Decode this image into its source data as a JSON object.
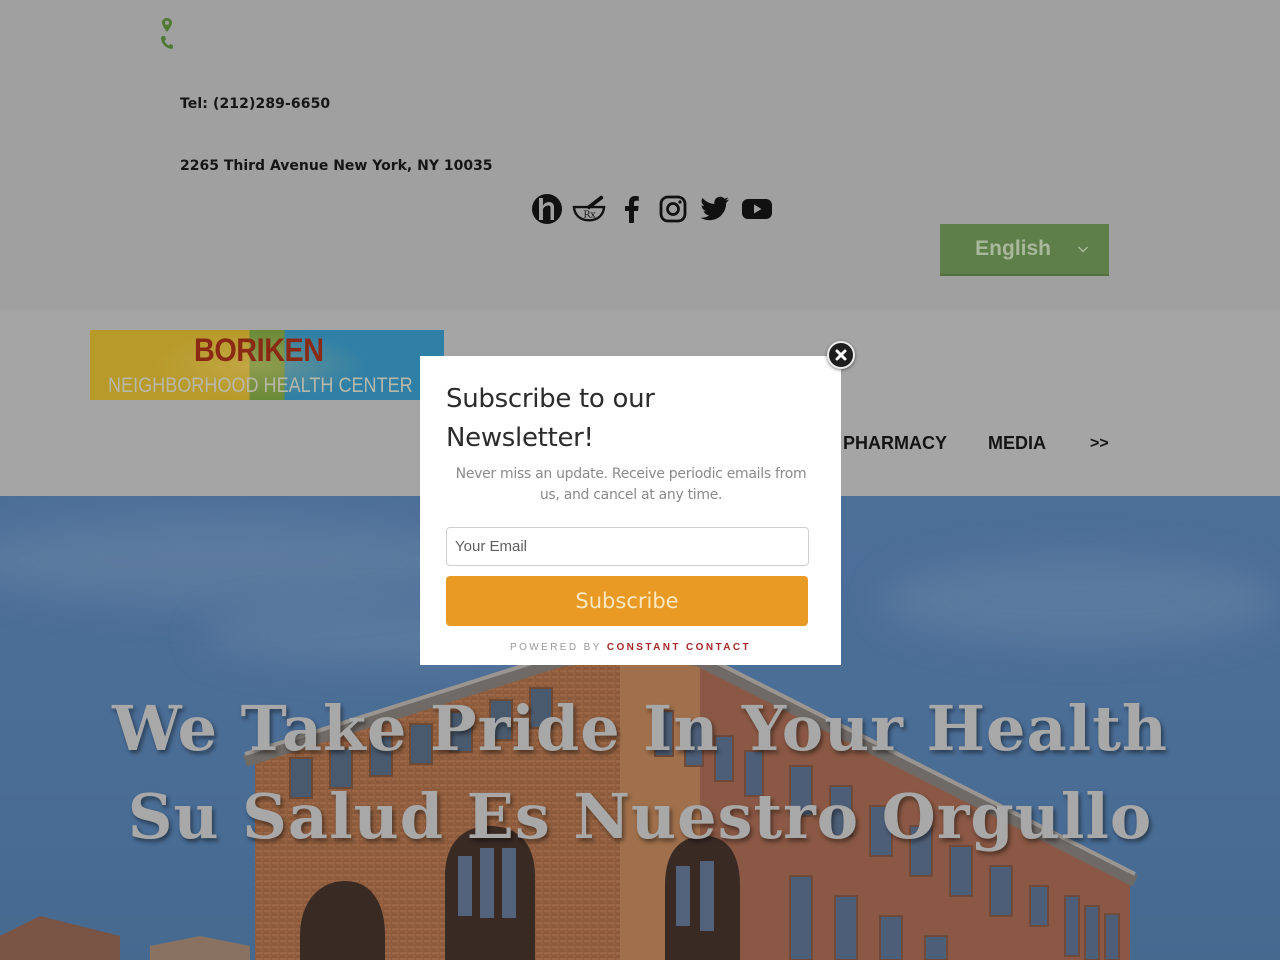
{
  "contact": {
    "icons": [
      "map-pin-icon",
      "phone-icon"
    ],
    "icon_color": "#4f7a33",
    "tel": "Tel: (212)289-6650",
    "address": "2265 Third Avenue New York, NY 10035"
  },
  "social": [
    {
      "name": "healthgrades",
      "icon": "h-logo-icon"
    },
    {
      "name": "pharmacy",
      "icon": "mortar-pestle-rx-icon"
    },
    {
      "name": "facebook",
      "icon": "facebook-icon"
    },
    {
      "name": "instagram",
      "icon": "instagram-icon"
    },
    {
      "name": "twitter",
      "icon": "twitter-icon"
    },
    {
      "name": "youtube",
      "icon": "youtube-icon"
    }
  ],
  "language": {
    "selected": "English",
    "bg_color": "#5e7f4a"
  },
  "logo": {
    "line1": "BORIKEN",
    "line2": "NEIGHBORHOOD HEALTH CENTER"
  },
  "nav": {
    "items": [
      "PHARMACY",
      "MEDIA",
      ">>"
    ]
  },
  "hero": {
    "line1": "We Take Pride In Your Health",
    "line2": "Su Salud Es Nuestro Orgullo"
  },
  "modal": {
    "title": "Subscribe to our Newsletter!",
    "description": "Never miss an update. Receive periodic emails from us, and cancel at any time.",
    "email_placeholder": "Your Email",
    "email_value": "",
    "subscribe_label": "Subscribe",
    "subscribe_color": "#e89a24",
    "powered_by": "POWERED BY",
    "powered_brand": "CONSTANT CONTACT",
    "close_icon": "close-icon"
  }
}
